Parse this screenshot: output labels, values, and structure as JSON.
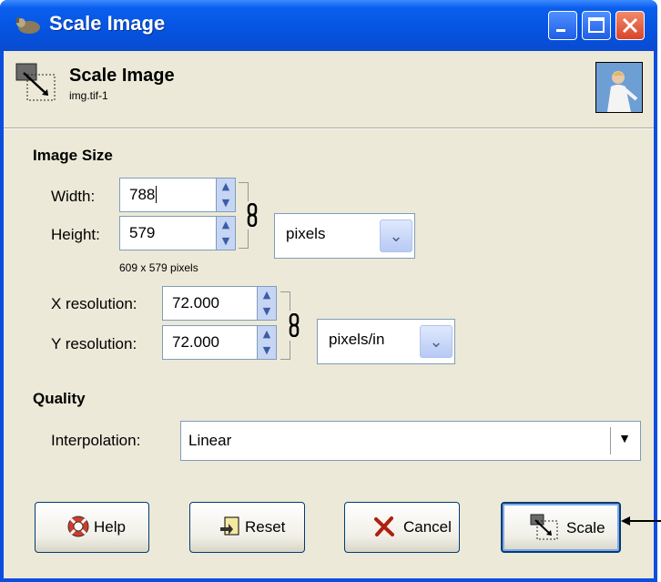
{
  "window": {
    "title": "Scale Image"
  },
  "header": {
    "title": "Scale Image",
    "subtitle": "img.tif-1"
  },
  "image_size": {
    "section": "Image Size",
    "width_label": "Width:",
    "width_value": "788",
    "height_label": "Height:",
    "height_value": "579",
    "size_info": "609 x 579 pixels",
    "unit": "pixels",
    "xres_label": "X resolution:",
    "xres_value": "72.000",
    "yres_label": "Y resolution:",
    "yres_value": "72.000",
    "res_unit": "pixels/in"
  },
  "quality": {
    "section": "Quality",
    "interp_label": "Interpolation:",
    "interp_value": "Linear"
  },
  "buttons": {
    "help": "Help",
    "reset": "Reset",
    "cancel": "Cancel",
    "scale": "Scale"
  },
  "colors": {
    "titlebar": "#0553e0",
    "client": "#ece9d8",
    "close": "#d9442b"
  }
}
